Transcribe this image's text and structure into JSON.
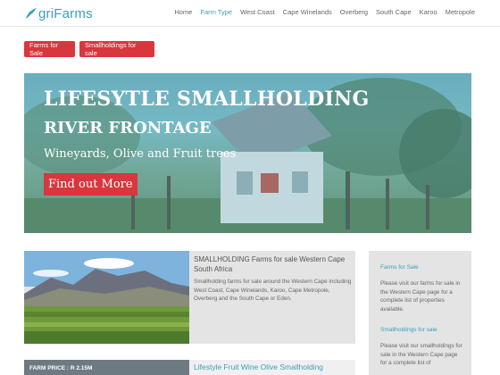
{
  "header": {
    "logo_text": "griFarms",
    "nav": [
      {
        "label": "Home"
      },
      {
        "label": "Farm Type"
      },
      {
        "label": "West Coast"
      },
      {
        "label": "Cape Winelands"
      },
      {
        "label": "Overberg"
      },
      {
        "label": "South Cape"
      },
      {
        "label": "Karoo"
      },
      {
        "label": "Metropole"
      }
    ],
    "active_nav": "Farm Type"
  },
  "category_buttons": [
    {
      "label": "Farms for Sale"
    },
    {
      "label": "Smallholdings for sale"
    }
  ],
  "hero": {
    "title_line1": "LIFESYTLE SMALLHOLDING",
    "title_line2": "RIVER FRONTAGE",
    "subtitle": "Wineyards, Olive and Fruit trees",
    "button_label": "Find out More"
  },
  "listings": [
    {
      "title": "SMALLHOLDING Farms for sale Western Cape South Africa",
      "text": "Smallholding farms for sale around the Western Cape including West Coast, Cape Winelands, Karoo, Cape Metropole, Overberg and the South Cape or Eden."
    },
    {
      "price": "FARM PRICE : R 2.15M",
      "title": "Lifestyle Fruit Wine Olive Smallholding"
    }
  ],
  "sidebar": {
    "farms_heading": "Farms for Sale",
    "farms_text": "Please visit our farms for sale in the Western Cape page for a complete list of properties available.",
    "smallholdings_heading": "Smallholdings for sale",
    "smallholdings_text": "Please visit our smallholdings for sale in the Western Cape page for a complete list of"
  },
  "colors": {
    "accent": "#3aa0b8",
    "button_red": "#d9363e",
    "panel_grey": "#e4e4e4"
  }
}
